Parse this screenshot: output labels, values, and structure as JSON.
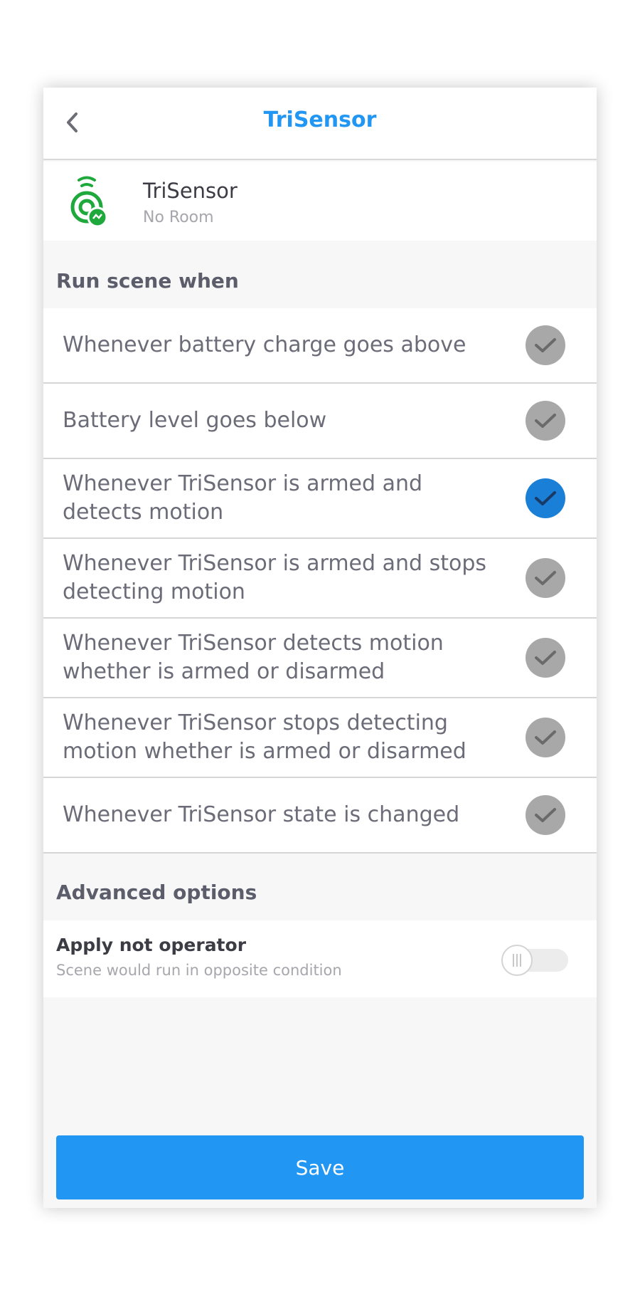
{
  "header": {
    "title": "TriSensor",
    "back_icon": "chevron-left-icon"
  },
  "device": {
    "name": "TriSensor",
    "room": "No Room",
    "icon": "trisensor-icon",
    "icon_color": "#1fa83c"
  },
  "section_run": {
    "title": "Run scene when"
  },
  "options": [
    {
      "label": "Whenever battery charge goes above",
      "checked": false
    },
    {
      "label": "Battery level goes below",
      "checked": false
    },
    {
      "label": "Whenever TriSensor is armed and detects motion",
      "checked": true
    },
    {
      "label": "Whenever TriSensor is armed and stops detecting motion",
      "checked": false
    },
    {
      "label": "Whenever TriSensor detects motion whether is armed or disarmed",
      "checked": false
    },
    {
      "label": "Whenever TriSensor stops detecting motion whether is armed or disarmed",
      "checked": false
    },
    {
      "label": "Whenever TriSensor state is changed",
      "checked": false
    }
  ],
  "section_advanced": {
    "title": "Advanced options"
  },
  "advanced": {
    "title": "Apply not operator",
    "subtitle": "Scene would run in opposite condition",
    "toggle_on": false
  },
  "save": {
    "label": "Save"
  },
  "colors": {
    "accent": "#2196f3",
    "checked": "#1a7fd6",
    "unchecked": "#a8a8a8"
  }
}
